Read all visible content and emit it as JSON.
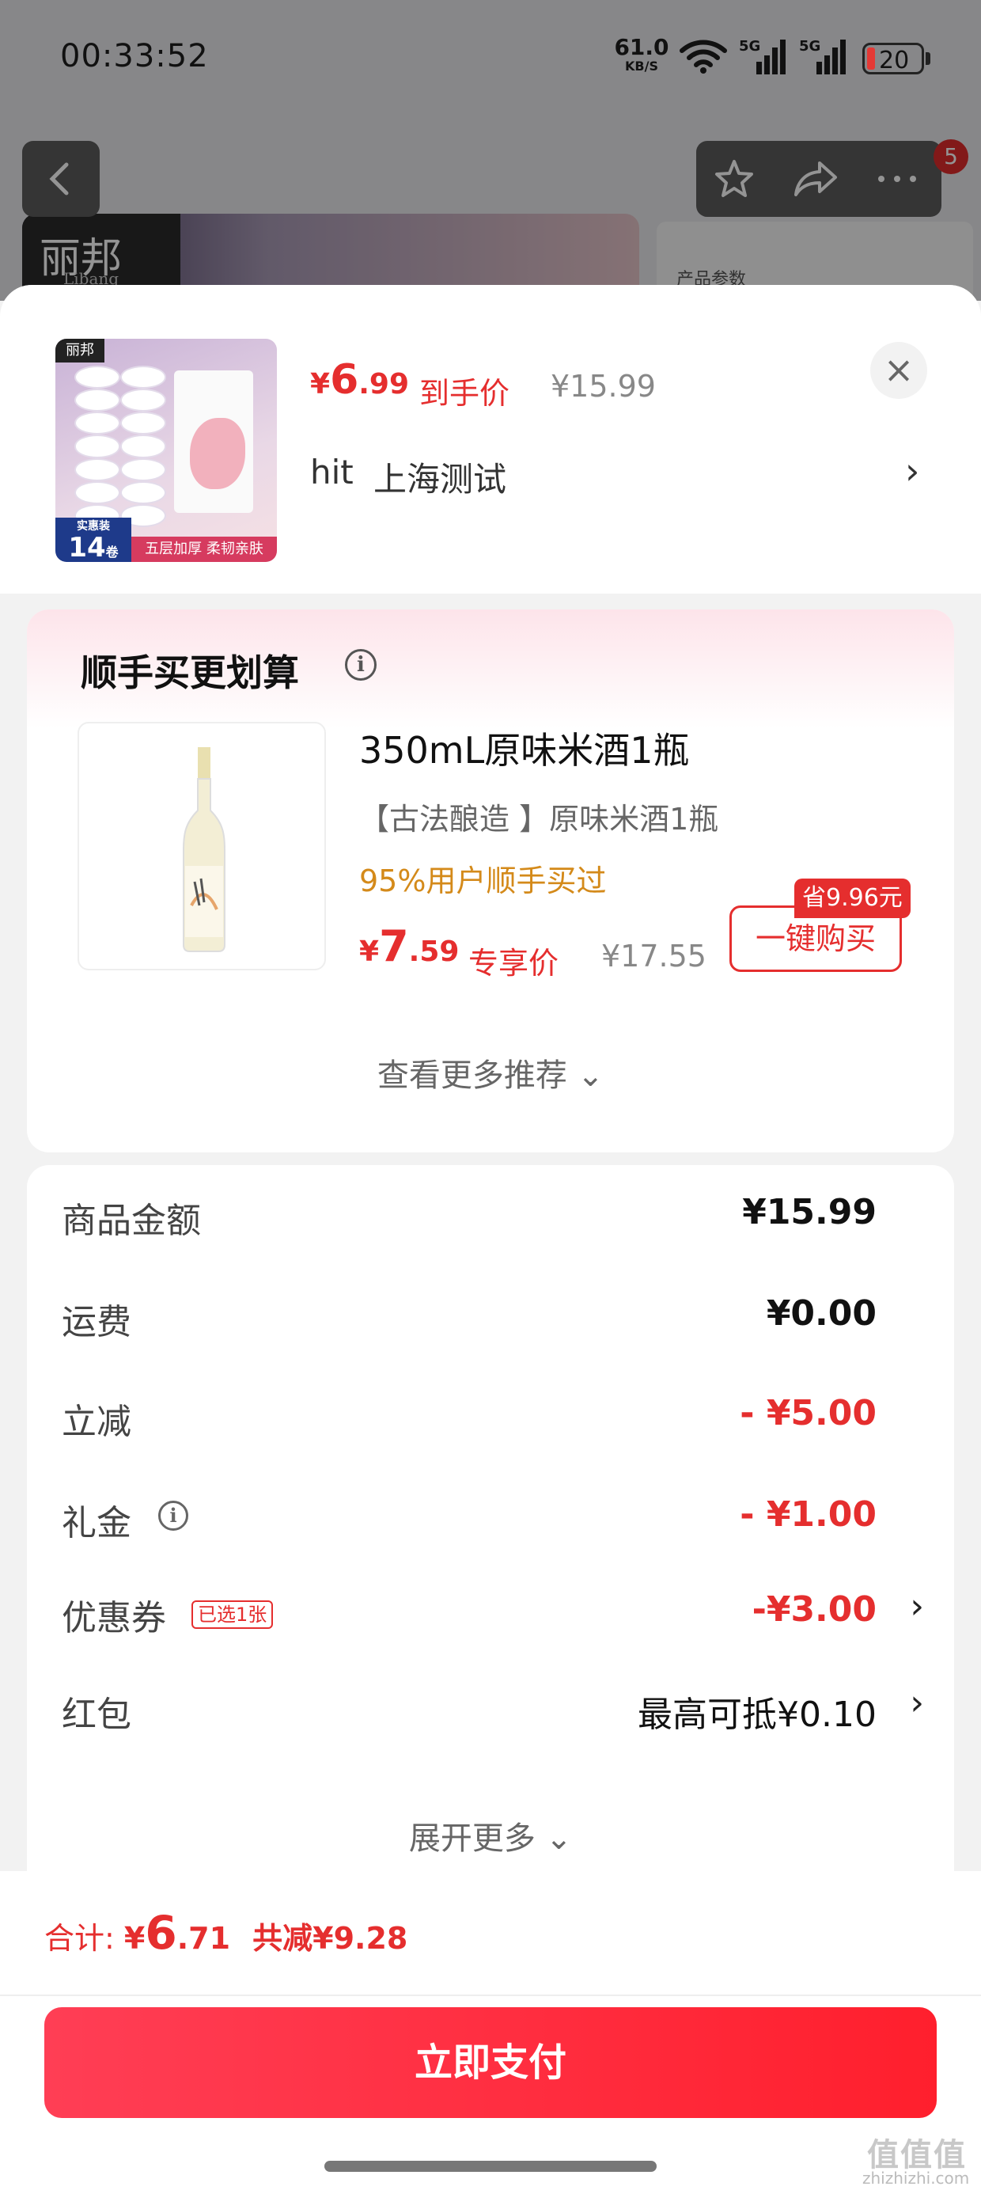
{
  "status_bar": {
    "time": "00:33:52",
    "net_speed": "61.0",
    "net_speed_unit": "KB/S",
    "network_1": "5G",
    "network_2": "5G",
    "battery": "20"
  },
  "background": {
    "brand_logo": "丽邦",
    "brand_sub": "Libang",
    "param_text": "产品参数",
    "cart_badge": "5",
    "icons": [
      "back-icon",
      "star-icon",
      "share-icon",
      "more-icon"
    ]
  },
  "product": {
    "thumb_brand": "丽邦",
    "thumb_count_label": "实惠装",
    "thumb_count": "14",
    "thumb_count_unit": "卷",
    "thumb_tagline": "五层加厚 柔韧亲肤",
    "price_yen": "¥",
    "price_int": "6",
    "price_dec": ".99",
    "price_label": "到手价",
    "original_price": "¥15.99"
  },
  "address": {
    "name": "hit",
    "detail": "上海测试"
  },
  "recommend": {
    "title": "顺手买更划算",
    "item_name": "350mL原味米酒1瓶",
    "item_sub": "【古法酿造 】原味米酒1瓶",
    "item_tag": "95%用户顺手买过",
    "price_yen": "¥",
    "price_int": "7",
    "price_dec": ".59",
    "price_label": "专享价",
    "original_price": "¥17.55",
    "save_badge": "省9.96元",
    "buy_label": "一键购买",
    "more_label": "查看更多推荐",
    "more_chevron": "⌄"
  },
  "summary": {
    "rows": [
      {
        "label": "商品金额",
        "value": "¥15.99"
      },
      {
        "label": "运费",
        "value": "¥0.00"
      },
      {
        "label": "立减",
        "value": "- ¥5.00"
      },
      {
        "label": "礼金",
        "value": "- ¥1.00"
      },
      {
        "label": "优惠券",
        "value": "-¥3.00",
        "tag": "已选1张"
      },
      {
        "label": "红包",
        "value": "最高可抵¥0.10"
      }
    ],
    "more_label": "展开更多",
    "more_chevron": "⌄",
    "accent_color": "#e52e2e"
  },
  "footer": {
    "total_label": "合计:",
    "total_yen": "¥",
    "total_int": "6",
    "total_dec": ".71",
    "saved_text": "共减¥9.28",
    "pay_label": "立即支付"
  },
  "watermark": {
    "logo": "值值值",
    "text": "zhizhizhi.com"
  }
}
